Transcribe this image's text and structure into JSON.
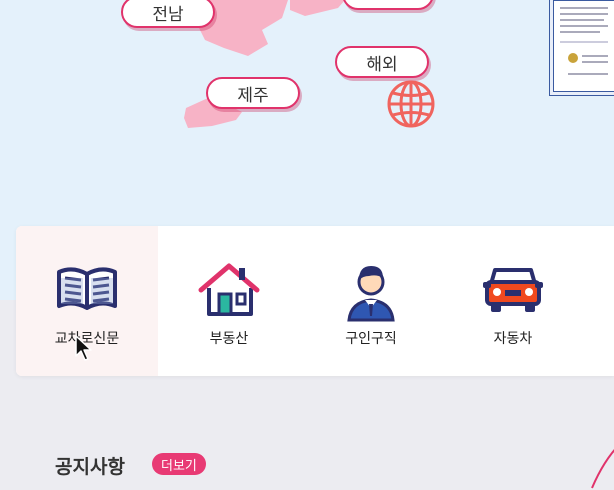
{
  "map": {
    "regions": [
      {
        "id": "jeonnam",
        "label": "전남"
      },
      {
        "id": "overseas",
        "label": "해외"
      },
      {
        "id": "jeju",
        "label": "제주"
      }
    ],
    "colors": {
      "land": "#f7b3c6",
      "accent": "#e0336b",
      "globe": "#f0645e",
      "sea": "#e4f1fb"
    }
  },
  "categories": [
    {
      "label": "교차로신문",
      "icon": "newspaper-icon"
    },
    {
      "label": "부동산",
      "icon": "house-icon"
    },
    {
      "label": "구인구직",
      "icon": "job-seeker-icon"
    },
    {
      "label": "자동차",
      "icon": "car-icon"
    }
  ],
  "notice": {
    "title": "공지사항",
    "more_label": "더보기"
  }
}
